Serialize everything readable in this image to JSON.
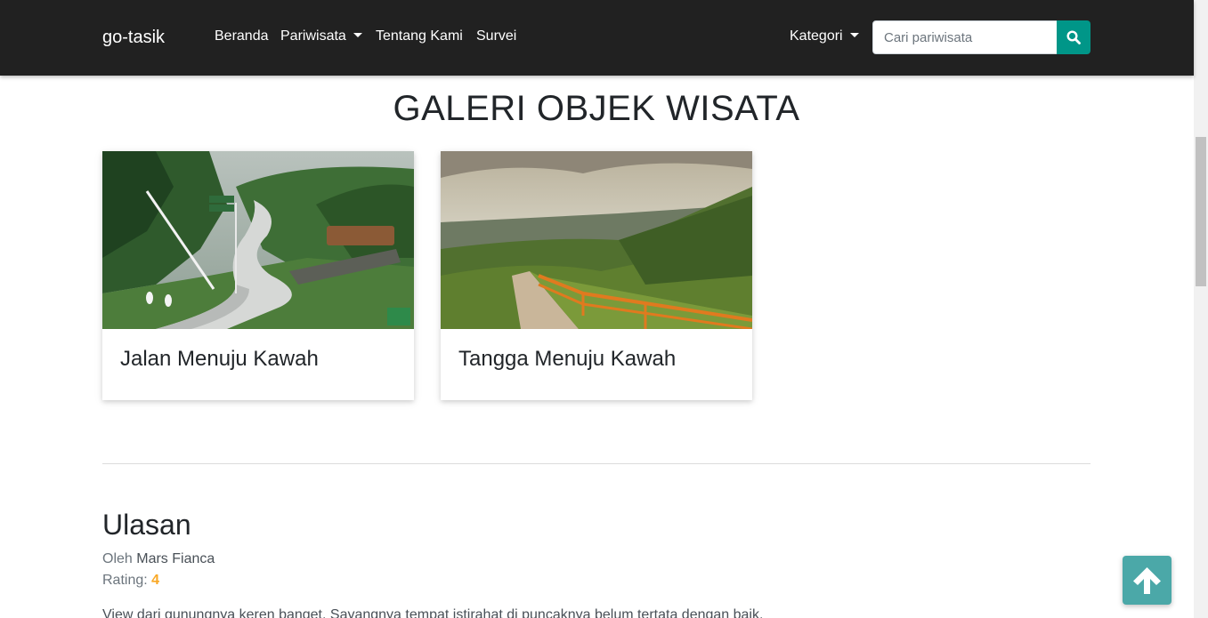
{
  "navbar": {
    "brand": "go-tasik",
    "links": [
      {
        "label": "Beranda"
      },
      {
        "label": "Pariwisata"
      },
      {
        "label": "Tentang Kami"
      },
      {
        "label": "Survei"
      }
    ],
    "category_label": "Kategori",
    "search": {
      "placeholder": "Cari pariwisata",
      "value": "",
      "button_icon": "search-icon"
    },
    "colors": {
      "background": "#212121",
      "accent": "#009688"
    }
  },
  "gallery": {
    "title": "GALERI OBJEK WISATA",
    "cards": [
      {
        "caption": "Jalan Menuju Kawah",
        "image": "winding road with sign and ducks"
      },
      {
        "caption": "Tangga Menuju Kawah",
        "image": "wooden stairs through green hills"
      }
    ]
  },
  "reviews": {
    "heading": "Ulasan",
    "items": [
      {
        "by_label": "Oleh",
        "author": "Mars Fianca",
        "rating_label": "Rating:",
        "rating": "4",
        "text": "View dari gunungnya keren banget. Sayangnya tempat istirahat di puncaknya belum tertata dengan baik."
      }
    ]
  },
  "back_to_top": {
    "icon": "arrow-up-icon",
    "color": "#4ba8a8"
  }
}
